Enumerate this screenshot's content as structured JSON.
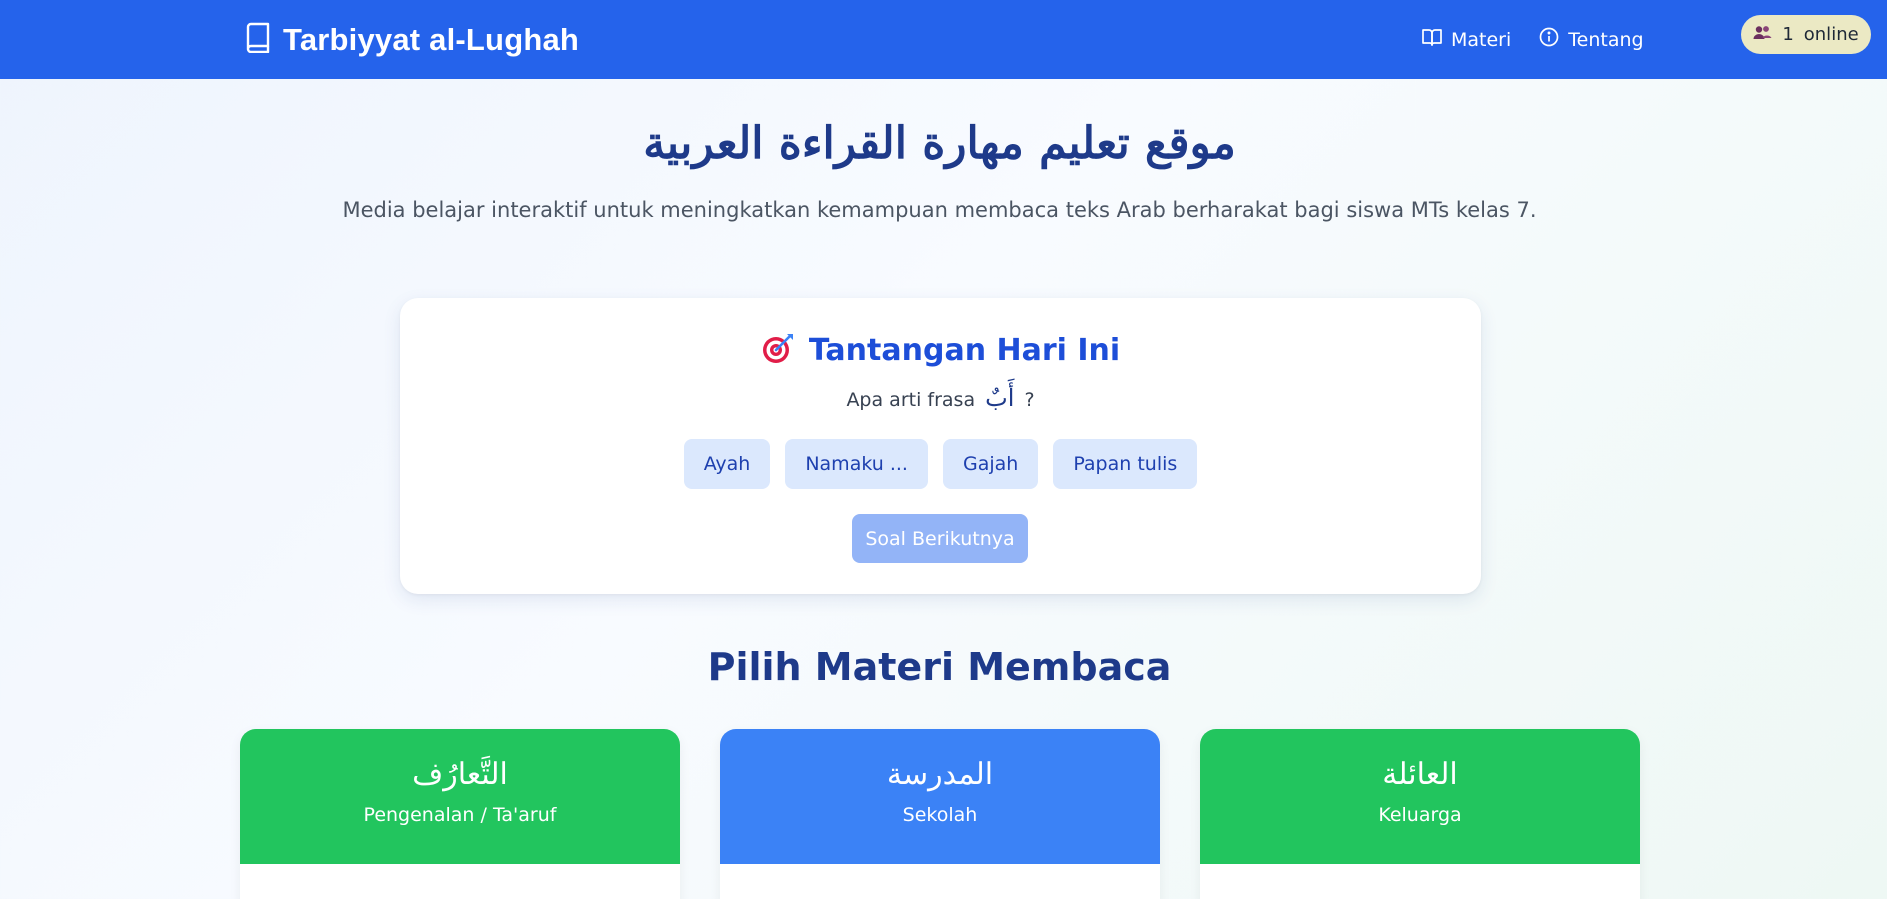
{
  "navbar": {
    "brand": "Tarbiyyat al-Lughah",
    "brand_icon": "book-icon",
    "links": [
      {
        "label": "Materi",
        "icon": "open-book-icon"
      },
      {
        "label": "Tentang",
        "icon": "info-icon"
      }
    ],
    "online": {
      "count": "1",
      "label": "online",
      "icon": "users-icon"
    },
    "color": "#2563eb"
  },
  "hero": {
    "title": "موقع تعليم مهارة القراءة العربية",
    "subtitle": "Media belajar interaktif untuk meningkatkan kemampuan membaca teks Arab berharakat bagi siswa MTs kelas 7."
  },
  "challenge": {
    "icon": "target-icon",
    "title": "Tantangan Hari Ini",
    "question_prefix": "Apa arti frasa",
    "question_word": "أَبٌ",
    "question_suffix": "?",
    "options": [
      "Ayah",
      "Namaku ...",
      "Gajah",
      "Papan tulis"
    ],
    "next_label": "Soal Berikutnya"
  },
  "materials": {
    "title": "Pilih Materi Membaca",
    "cards": [
      {
        "arabic": "التَّعارُف",
        "label": "Pengenalan / Ta'aruf",
        "color": "#22c55e"
      },
      {
        "arabic": "المدرسة",
        "label": "Sekolah",
        "color": "#3b82f6"
      },
      {
        "arabic": "العائلة",
        "label": "Keluarga",
        "color": "#22c55e"
      }
    ]
  }
}
